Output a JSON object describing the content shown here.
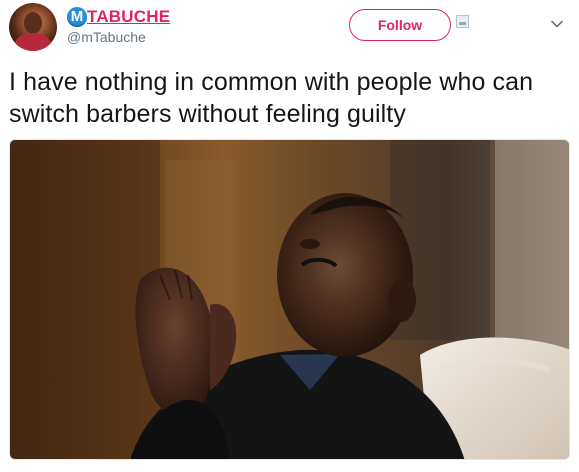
{
  "author": {
    "logo_letter": "M",
    "display_name": "TABUCHE",
    "handle": "@mTabuche",
    "name_color": "#e0245e",
    "logo_color": "#2a8fd9"
  },
  "follow_button": {
    "label": "Follow",
    "color": "#e0245e"
  },
  "tweet": {
    "text": "I have nothing in common with people who can switch barbers without feeling guilty"
  },
  "icons": {
    "more": "chevron-down-icon",
    "broken_image": "image-placeholder-icon"
  }
}
